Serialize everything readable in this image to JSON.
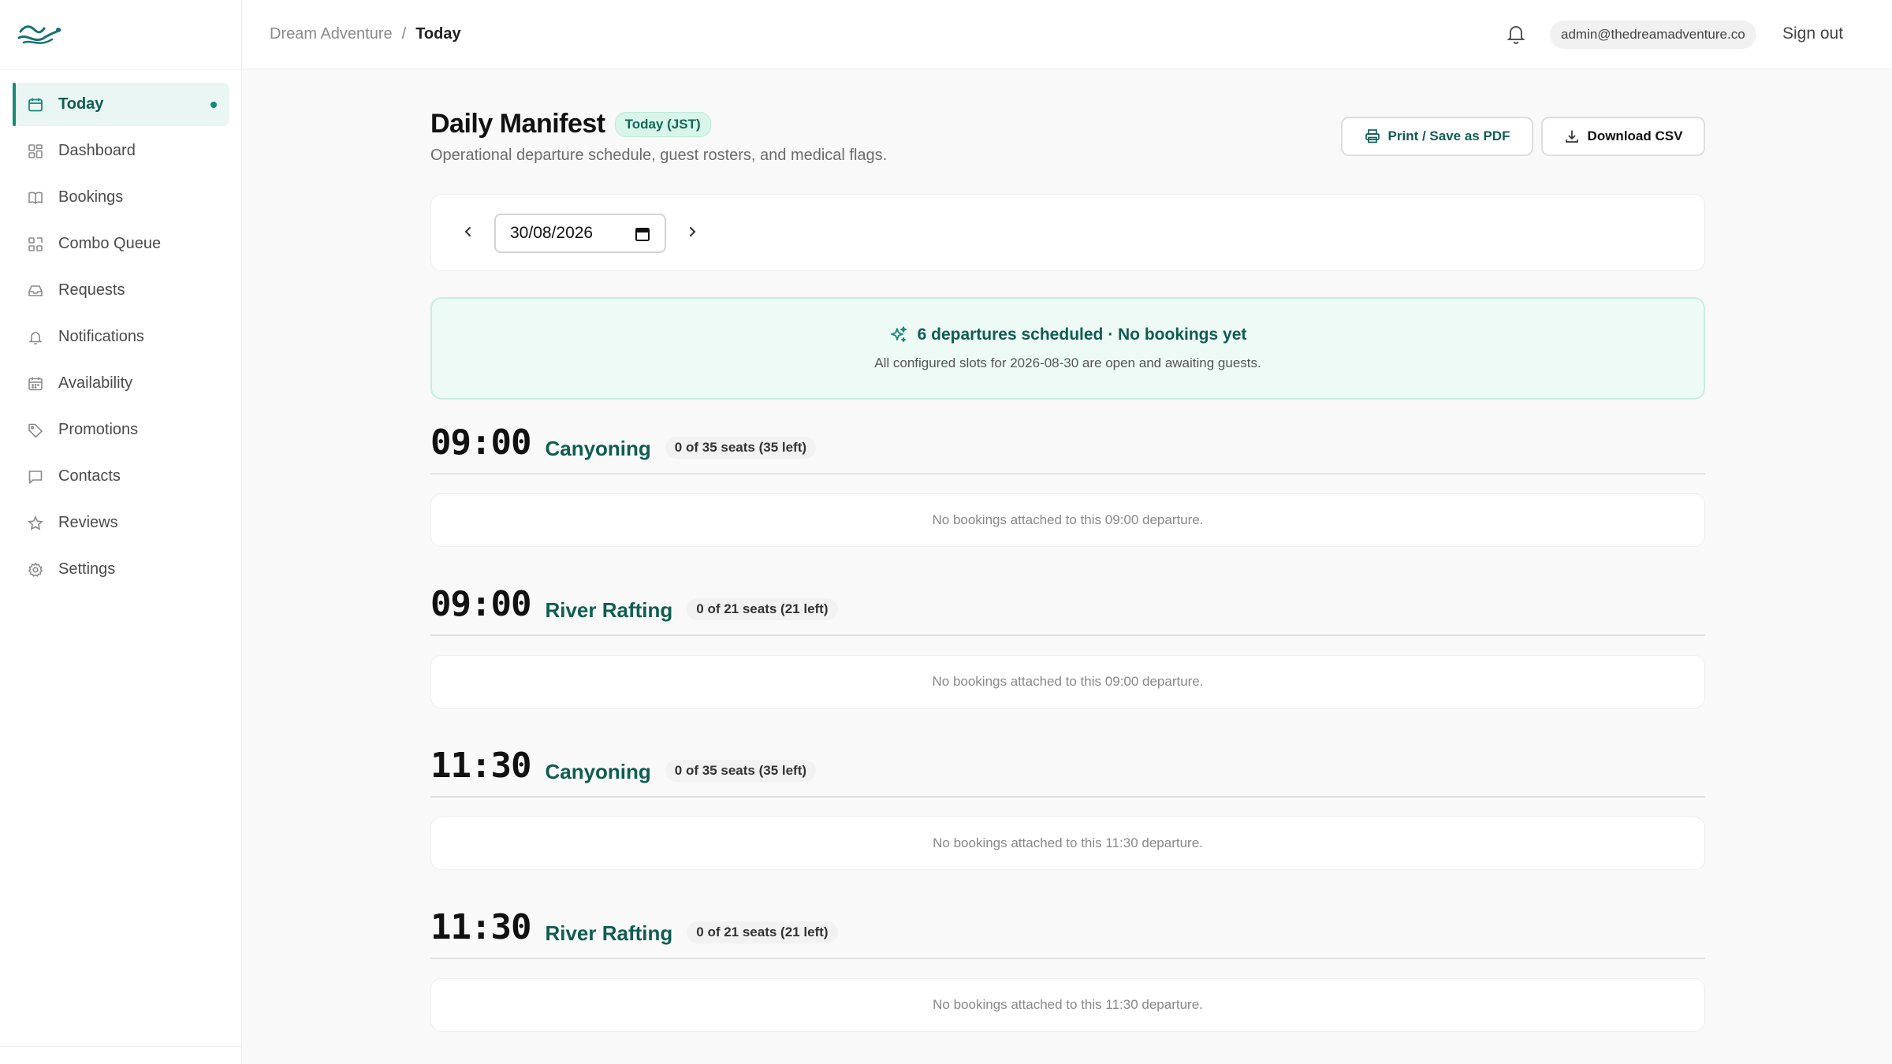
{
  "app": {
    "brand_color": "#148a78",
    "breadcrumb": {
      "root": "Dream Adventure",
      "separator": "/",
      "current": "Today"
    }
  },
  "sidebar": {
    "items": [
      {
        "label": "Today",
        "icon": "calendar-icon",
        "active": true
      },
      {
        "label": "Dashboard",
        "icon": "grid-icon"
      },
      {
        "label": "Bookings",
        "icon": "book-icon"
      },
      {
        "label": "Combo Queue",
        "icon": "combo-queue-icon"
      },
      {
        "label": "Requests",
        "icon": "inbox-icon"
      },
      {
        "label": "Notifications",
        "icon": "bell-icon"
      },
      {
        "label": "Availability",
        "icon": "calendar-grid-icon"
      },
      {
        "label": "Promotions",
        "icon": "tag-icon"
      },
      {
        "label": "Contacts",
        "icon": "chat-icon"
      },
      {
        "label": "Reviews",
        "icon": "star-icon"
      },
      {
        "label": "Settings",
        "icon": "gear-icon"
      }
    ]
  },
  "header": {
    "user_email": "admin@thedreamadventure.co",
    "sign_out_label": "Sign out"
  },
  "page": {
    "title": "Daily Manifest",
    "badge": "Today (JST)",
    "subtitle": "Operational departure schedule, guest rosters, and medical flags.",
    "print_label": "Print / Save as PDF",
    "csv_label": "Download CSV"
  },
  "date_picker": {
    "value": "30/08/2026"
  },
  "banner": {
    "title": "6 departures scheduled · No bookings yet",
    "subtitle": "All configured slots for 2026-08-30 are open and awaiting guests."
  },
  "departures": [
    {
      "time": "09:00",
      "activity": "Canyoning",
      "seats": "0 of 35 seats (35 left)",
      "empty_message": "No bookings attached to this 09:00 departure."
    },
    {
      "time": "09:00",
      "activity": "River Rafting",
      "seats": "0 of 21 seats (21 left)",
      "empty_message": "No bookings attached to this 09:00 departure."
    },
    {
      "time": "11:30",
      "activity": "Canyoning",
      "seats": "0 of 35 seats (35 left)",
      "empty_message": "No bookings attached to this 11:30 departure."
    },
    {
      "time": "11:30",
      "activity": "River Rafting",
      "seats": "0 of 21 seats (21 left)",
      "empty_message": "No bookings attached to this 11:30 departure."
    }
  ]
}
